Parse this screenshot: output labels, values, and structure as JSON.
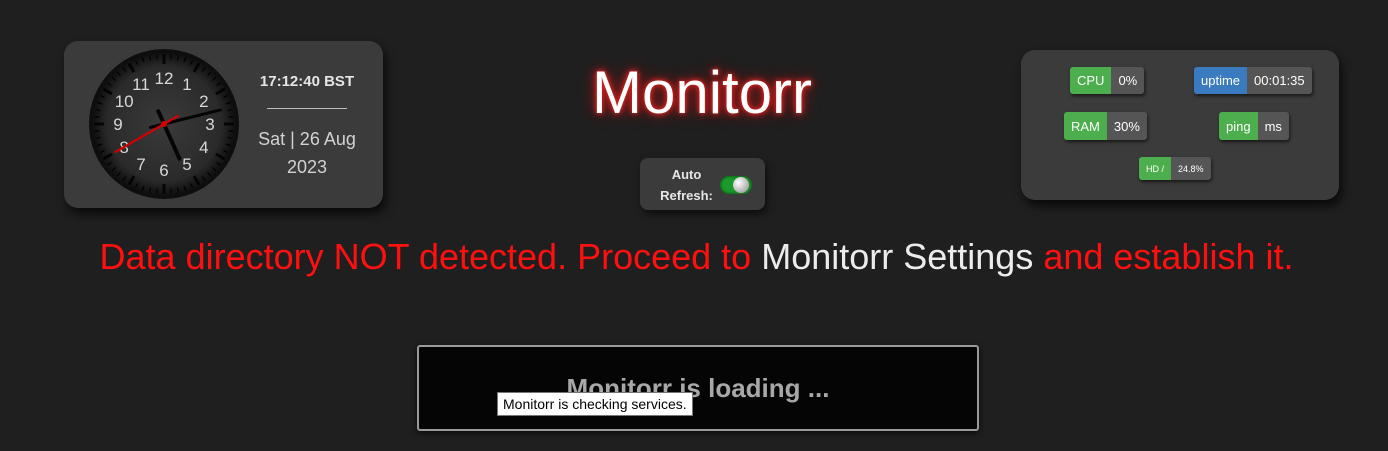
{
  "clock": {
    "time": "17:12:40 BST",
    "date_line1": "Sat | 26 Aug",
    "date_line2": "2023",
    "numerals": [
      "12",
      "1",
      "2",
      "3",
      "4",
      "5",
      "6",
      "7",
      "8",
      "9",
      "10",
      "11"
    ],
    "hands": {
      "hour": 17,
      "minute": 12,
      "second": 40
    }
  },
  "title": "Monitorr",
  "autorefresh": {
    "label_line1": "Auto",
    "label_line2": "Refresh:",
    "enabled": true
  },
  "stats": {
    "cpu": {
      "label": "CPU",
      "value": "0%"
    },
    "uptime": {
      "label": "uptime",
      "value": "00:01:35"
    },
    "ram": {
      "label": "RAM",
      "value": "30%"
    },
    "ping": {
      "label": "ping",
      "value": "ms"
    },
    "hd": {
      "label": "HD /",
      "value": "24.8%"
    }
  },
  "error": {
    "part1": "Data directory NOT detected. Proceed to ",
    "link": "Monitorr Settings",
    "part2": " and establish it."
  },
  "loading": {
    "text": "Monitorr is loading ...",
    "tooltip": "Monitorr is checking services."
  },
  "colors": {
    "error": "#ff1010",
    "badge_green": "#4cae4c",
    "badge_blue": "#3a7bbf",
    "toggle_on": "#1a9a2a"
  }
}
